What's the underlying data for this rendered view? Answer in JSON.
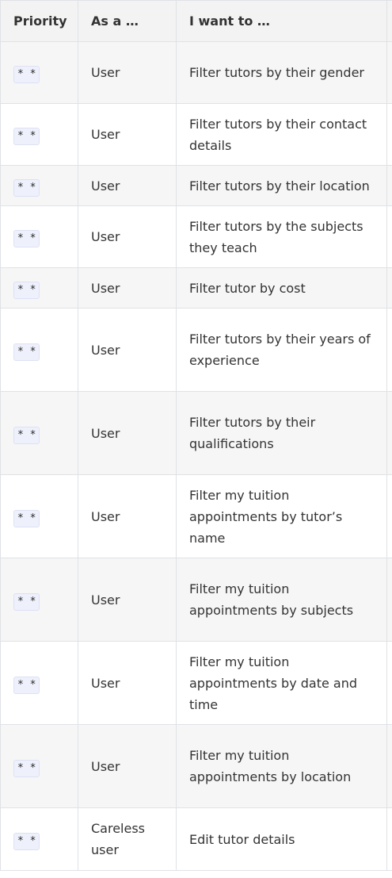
{
  "table": {
    "headers": [
      "Priority",
      "As a …",
      "I want to …"
    ],
    "rows": [
      {
        "priority": "* *",
        "as_a": "User",
        "want": "Filter tutors by their gender"
      },
      {
        "priority": "* *",
        "as_a": "User",
        "want": "Filter tutors by their contact details"
      },
      {
        "priority": "* *",
        "as_a": "User",
        "want": "Filter tutors by their location"
      },
      {
        "priority": "* *",
        "as_a": "User",
        "want": "Filter tutors by the subjects they teach"
      },
      {
        "priority": "* *",
        "as_a": "User",
        "want": "Filter tutor by cost"
      },
      {
        "priority": "* *",
        "as_a": "User",
        "want": "Filter tutors by their years of experience"
      },
      {
        "priority": "* *",
        "as_a": "User",
        "want": "Filter tutors by their qualifications"
      },
      {
        "priority": "* *",
        "as_a": "User",
        "want": "Filter my tuition appointments by tutor’s name"
      },
      {
        "priority": "* *",
        "as_a": "User",
        "want": "Filter my tuition appointments by subjects"
      },
      {
        "priority": "* *",
        "as_a": "User",
        "want": "Filter my tuition appointments by date and time"
      },
      {
        "priority": "* *",
        "as_a": "User",
        "want": "Filter my tuition appointments by location"
      },
      {
        "priority": "* *",
        "as_a": "Careless user",
        "want": "Edit tutor details"
      }
    ]
  }
}
